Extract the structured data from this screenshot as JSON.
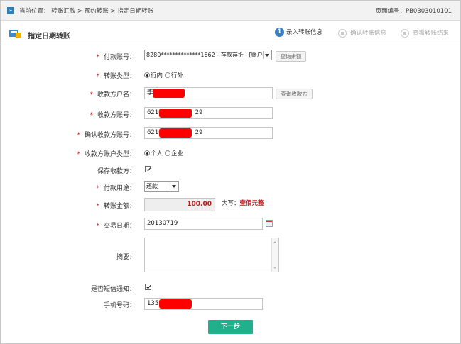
{
  "breadcrumb": {
    "badge": "»",
    "text": "当前位置： 转账汇款 > 预约转账 > 指定日期转账"
  },
  "page_no": "页面编号：PB0303010101",
  "title": "指定日期转账",
  "steps": [
    {
      "num": "1",
      "label": "录入转账信息",
      "active": true
    },
    {
      "label": "确认转账信息",
      "active": false
    },
    {
      "label": "查看转账结果",
      "active": false
    }
  ],
  "form": {
    "payer_account": {
      "label": "付款账号：",
      "value": "8280**************1662 - 存款存折 - [账户1]",
      "query_btn": "查询余额"
    },
    "transfer_type": {
      "label": "转账类型：",
      "options": [
        "行内",
        "行外"
      ],
      "selected": "行内"
    },
    "payee_name": {
      "label": "收款方户名：",
      "value": "李",
      "query_btn": "查询收款方"
    },
    "payee_account": {
      "label": "收款方账号：",
      "prefix": "6210",
      "suffix": "29"
    },
    "confirm_account": {
      "label": "确认收款方账号：",
      "prefix": "6210",
      "suffix": "29"
    },
    "payee_type": {
      "label": "收款方账户类型：",
      "options": [
        "个人",
        "企业"
      ],
      "selected": "个人"
    },
    "save_payee": {
      "label": "保存收款方：",
      "checked": true
    },
    "purpose": {
      "label": "付款用途：",
      "value": "还款"
    },
    "amount": {
      "label": "转账金额：",
      "value": "100.00",
      "upper_label": "大写：",
      "upper_value": "壹佰元整"
    },
    "date": {
      "label": "交易日期：",
      "value": "20130719"
    },
    "remark": {
      "label": "摘要：",
      "value": ""
    },
    "sms": {
      "label": "是否短信通知：",
      "checked": true
    },
    "phone": {
      "label": "手机号码：",
      "prefix": "1351"
    }
  },
  "next_button": "下一步",
  "colors": {
    "accent": "#22b08c",
    "required_star": "#d32020",
    "amount_text": "#c0181a",
    "redaction": "#ff0000",
    "step_active": "#3a7fc4"
  }
}
